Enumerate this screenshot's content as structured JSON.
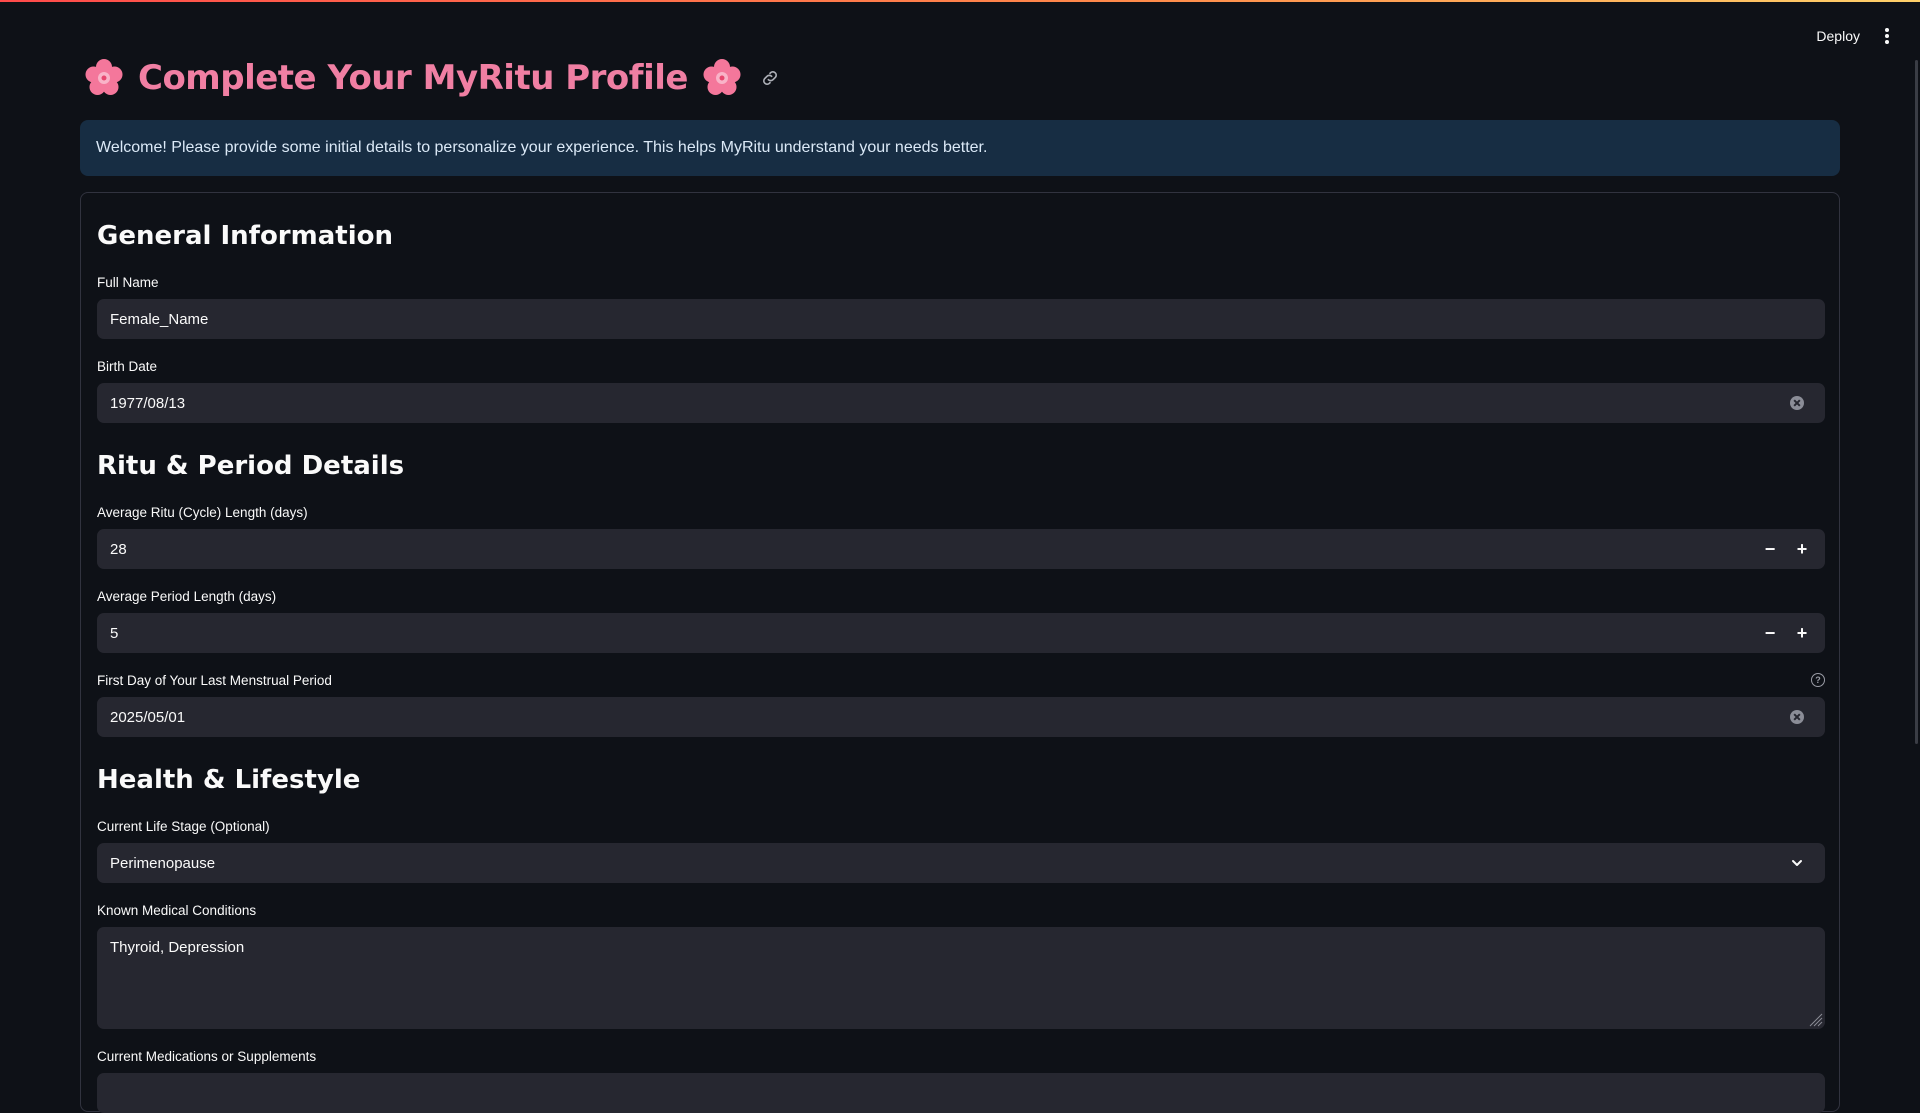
{
  "header": {
    "deploy_label": "Deploy",
    "menu_icon": "kebab-menu-icon"
  },
  "page": {
    "title": "Complete Your MyRitu Profile",
    "title_icon": "cherry-blossom-icon",
    "anchor_icon": "link-icon",
    "banner": "Welcome! Please provide some initial details to personalize your experience. This helps MyRitu understand your needs better."
  },
  "general": {
    "heading": "General Information",
    "full_name": {
      "label": "Full Name",
      "value": "Female_Name"
    },
    "birth_date": {
      "label": "Birth Date",
      "value": "1977/08/13"
    }
  },
  "ritu": {
    "heading": "Ritu & Period Details",
    "cycle_length": {
      "label": "Average Ritu (Cycle) Length (days)",
      "value": "28",
      "minus": "−",
      "plus": "+"
    },
    "period_length": {
      "label": "Average Period Length (days)",
      "value": "5",
      "minus": "−",
      "plus": "+"
    },
    "last_period": {
      "label": "First Day of Your Last Menstrual Period",
      "value": "2025/05/01",
      "help": "?"
    }
  },
  "health": {
    "heading": "Health & Lifestyle",
    "life_stage": {
      "label": "Current Life Stage (Optional)",
      "value": "Perimenopause"
    },
    "medical_conditions": {
      "label": "Known Medical Conditions",
      "value": "Thyroid, Depression"
    },
    "medications": {
      "label": "Current Medications or Supplements"
    }
  },
  "colors": {
    "background": "#0e1117",
    "title": "#f07fa3",
    "banner_bg": "#172d43",
    "field_bg": "#262730"
  }
}
